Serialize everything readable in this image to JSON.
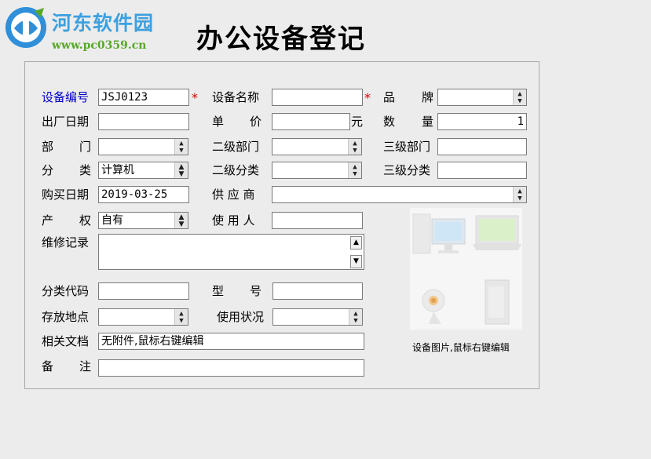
{
  "logo": {
    "title": "河东软件园",
    "url": "www.pc0359.cn"
  },
  "form_title": "办公设备登记",
  "labels": {
    "device_no": "设备编号",
    "device_name": "设备名称",
    "brand_a": "品",
    "brand_b": "牌",
    "mfg_date": "出厂日期",
    "unit_price_a": "单",
    "unit_price_b": "价",
    "currency": "元",
    "qty_a": "数",
    "qty_b": "量",
    "dept_a": "部",
    "dept_b": "门",
    "dept2": "二级部门",
    "dept3": "三级部门",
    "cat_a": "分",
    "cat_b": "类",
    "cat2": "二级分类",
    "cat3": "三级分类",
    "buy_date": "购买日期",
    "supplier": "供 应 商",
    "owner_a": "产",
    "owner_b": "权",
    "user": "使 用 人",
    "repair": "维修记录",
    "cat_code": "分类代码",
    "model_a": "型",
    "model_b": "号",
    "location": "存放地点",
    "status": "使用状况",
    "docs": "相关文档",
    "note_a": "备",
    "note_b": "注",
    "required_mark": "*"
  },
  "values": {
    "device_no": "JSJ0123",
    "device_name": "",
    "brand": "",
    "mfg_date": "",
    "unit_price": "",
    "qty": "1",
    "dept": "",
    "dept2": "",
    "dept3": "",
    "category": "计算机",
    "cat2": "",
    "cat3": "",
    "buy_date": "2019-03-25",
    "supplier": "",
    "ownership": "自有",
    "user": "",
    "repair": "",
    "cat_code": "",
    "model": "",
    "location": "",
    "status": "",
    "docs": "无附件,鼠标右键编辑",
    "note": ""
  },
  "image_caption": "设备图片,鼠标右键编辑",
  "icons": {
    "dropdown": "spin-arrows-icon",
    "scroll_up": "chevron-up-icon",
    "scroll_down": "chevron-down-icon"
  },
  "colors": {
    "required_label": "#0000c8",
    "required_star": "#dd0000",
    "logo_blue": "#3ca0df",
    "logo_green": "#58a82a"
  }
}
